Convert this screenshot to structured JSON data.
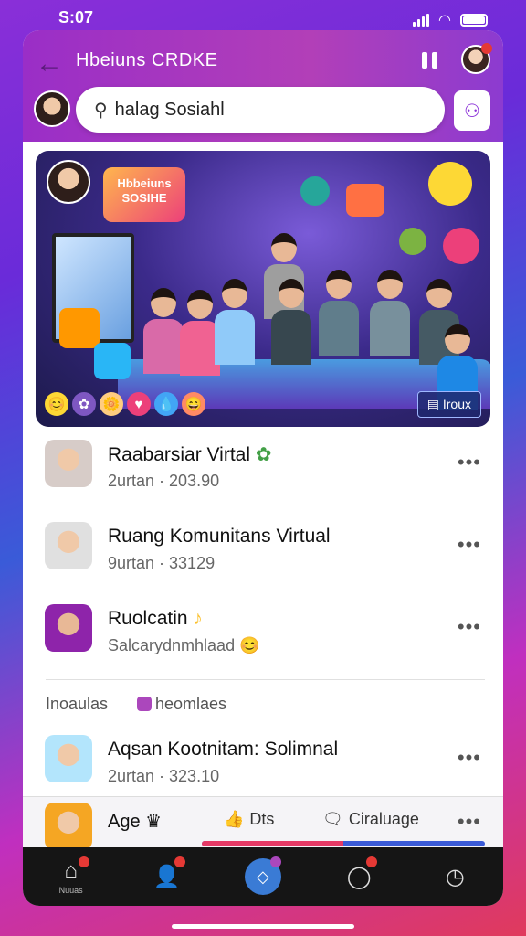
{
  "status": {
    "time": "S:07"
  },
  "header": {
    "title": "Hbeiuns CRDKE",
    "search_value": "halag Sosiahl"
  },
  "banner": {
    "logo_text": "Hbbeiuns SOSIHE",
    "button_label": "Iroux",
    "reactions": [
      "😊",
      "✿",
      "🌼",
      "♥",
      "💧",
      "😄"
    ]
  },
  "list": {
    "items": [
      {
        "title": "Raabarsiar Virtal",
        "subtitle": "2urtan · 203.90"
      },
      {
        "title": "Ruang Komunitans Virtual",
        "subtitle": "9urtan · 33129"
      },
      {
        "title": "Ruolcatin",
        "subtitle": "Salcarydnmhlaad"
      }
    ],
    "section_label": "Inoaulas",
    "section_chip": "heomlaes",
    "item4": {
      "title": "Aqsan Kootnitam: Solimnal",
      "subtitle": "2urtan · 323.10"
    }
  },
  "post_bar": {
    "author": "Age",
    "action_like": "Dts",
    "action_comment": "Ciraluage",
    "progress": 0.5
  },
  "nav": {
    "home_label": "Nuuas"
  },
  "colors": {
    "accent": "#9a2ec7",
    "nav_bg": "#151515",
    "badge": "#e53935"
  }
}
